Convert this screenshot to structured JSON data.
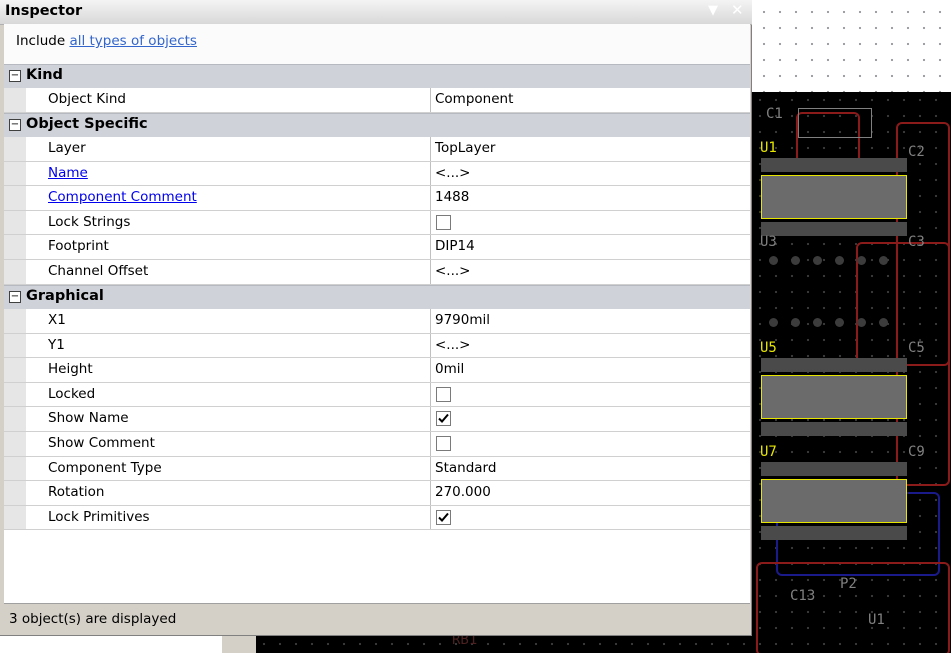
{
  "window": {
    "title": "Inspector"
  },
  "include": {
    "prefix": "Include",
    "link": "all types of objects"
  },
  "categories": [
    {
      "label": "Kind",
      "toggle": "⊟"
    },
    {
      "label": "Object Specific",
      "toggle": "⊟"
    },
    {
      "label": "Graphical",
      "toggle": "⊟"
    }
  ],
  "kind": [
    {
      "name": "Object Kind",
      "value": "Component"
    }
  ],
  "object_specific": [
    {
      "name": "Layer",
      "value": "TopLayer"
    },
    {
      "name": "Name",
      "value": "<...>"
    },
    {
      "name": "Component Comment",
      "value": "1488"
    },
    {
      "name": "Lock Strings",
      "checked": false
    },
    {
      "name": "Footprint",
      "value": "DIP14"
    },
    {
      "name": "Channel Offset",
      "value": "<...>"
    }
  ],
  "graphical": [
    {
      "name": "X1",
      "value": "9790mil"
    },
    {
      "name": "Y1",
      "value": "<...>"
    },
    {
      "name": "Height",
      "value": "0mil"
    },
    {
      "name": "Locked",
      "checked": false
    },
    {
      "name": "Show Name",
      "checked": true
    },
    {
      "name": "Show Comment",
      "checked": false
    },
    {
      "name": "Component Type",
      "value": "Standard"
    },
    {
      "name": "Rotation",
      "value": "270.000"
    },
    {
      "name": "Lock Primitives",
      "checked": true
    }
  ],
  "status": {
    "text": "3 object(s) are displayed"
  },
  "pcb_labels": {
    "c1": "C1",
    "u1": "U1",
    "c2": "C2",
    "u3": "U3",
    "c3": "C3",
    "u5": "U5",
    "c5": "C5",
    "u7": "U7",
    "c9": "C9",
    "c13": "C13",
    "p2": "P2",
    "u11": "U1",
    "rb": "RB1"
  },
  "colors": {
    "accent_link": "#3366cc",
    "pcb_label": "#e6e600",
    "pcb_ref": "#808080"
  }
}
